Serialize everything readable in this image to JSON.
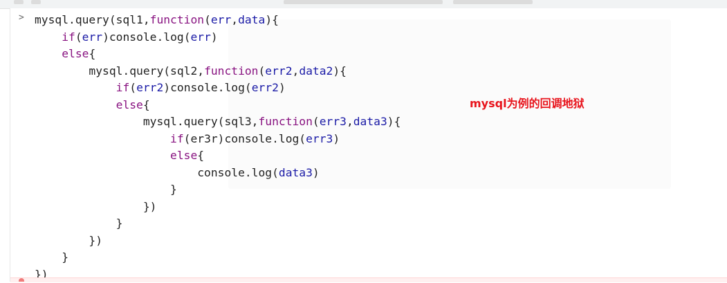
{
  "console": {
    "prompt": ">",
    "lines": [
      [
        "mysql.query(sql1,",
        "function",
        "(",
        "err",
        ",",
        "data",
        "){"
      ],
      [
        "    ",
        "if",
        "(",
        "err",
        ")console.log(",
        "err",
        ")"
      ],
      [
        "    ",
        "else",
        "{"
      ],
      [
        "        mysql.query(sql2,",
        "function",
        "(",
        "err2",
        ",",
        "data2",
        "){"
      ],
      [
        "            ",
        "if",
        "(",
        "err2",
        ")console.log(",
        "err2",
        ")"
      ],
      [
        "            ",
        "else",
        "{"
      ],
      [
        "                mysql.query(sql3,",
        "function",
        "(",
        "err3",
        ",",
        "data3",
        "){"
      ],
      [
        "                    ",
        "if",
        "(er3r)console.log(",
        "err3",
        ")"
      ],
      [
        "                    ",
        "else",
        "{"
      ],
      [
        "                        console.log(",
        "data3",
        ")"
      ],
      [
        "                    }"
      ],
      [
        "                })"
      ],
      [
        "            }"
      ],
      [
        "        })"
      ],
      [
        "    }"
      ],
      [
        "})"
      ]
    ]
  },
  "annotation": {
    "text": "mysql为例的回调地狱",
    "color": "#e8141c"
  },
  "colors": {
    "keyword": "#881280",
    "argument": "#1a1aa6",
    "text": "#222222"
  }
}
